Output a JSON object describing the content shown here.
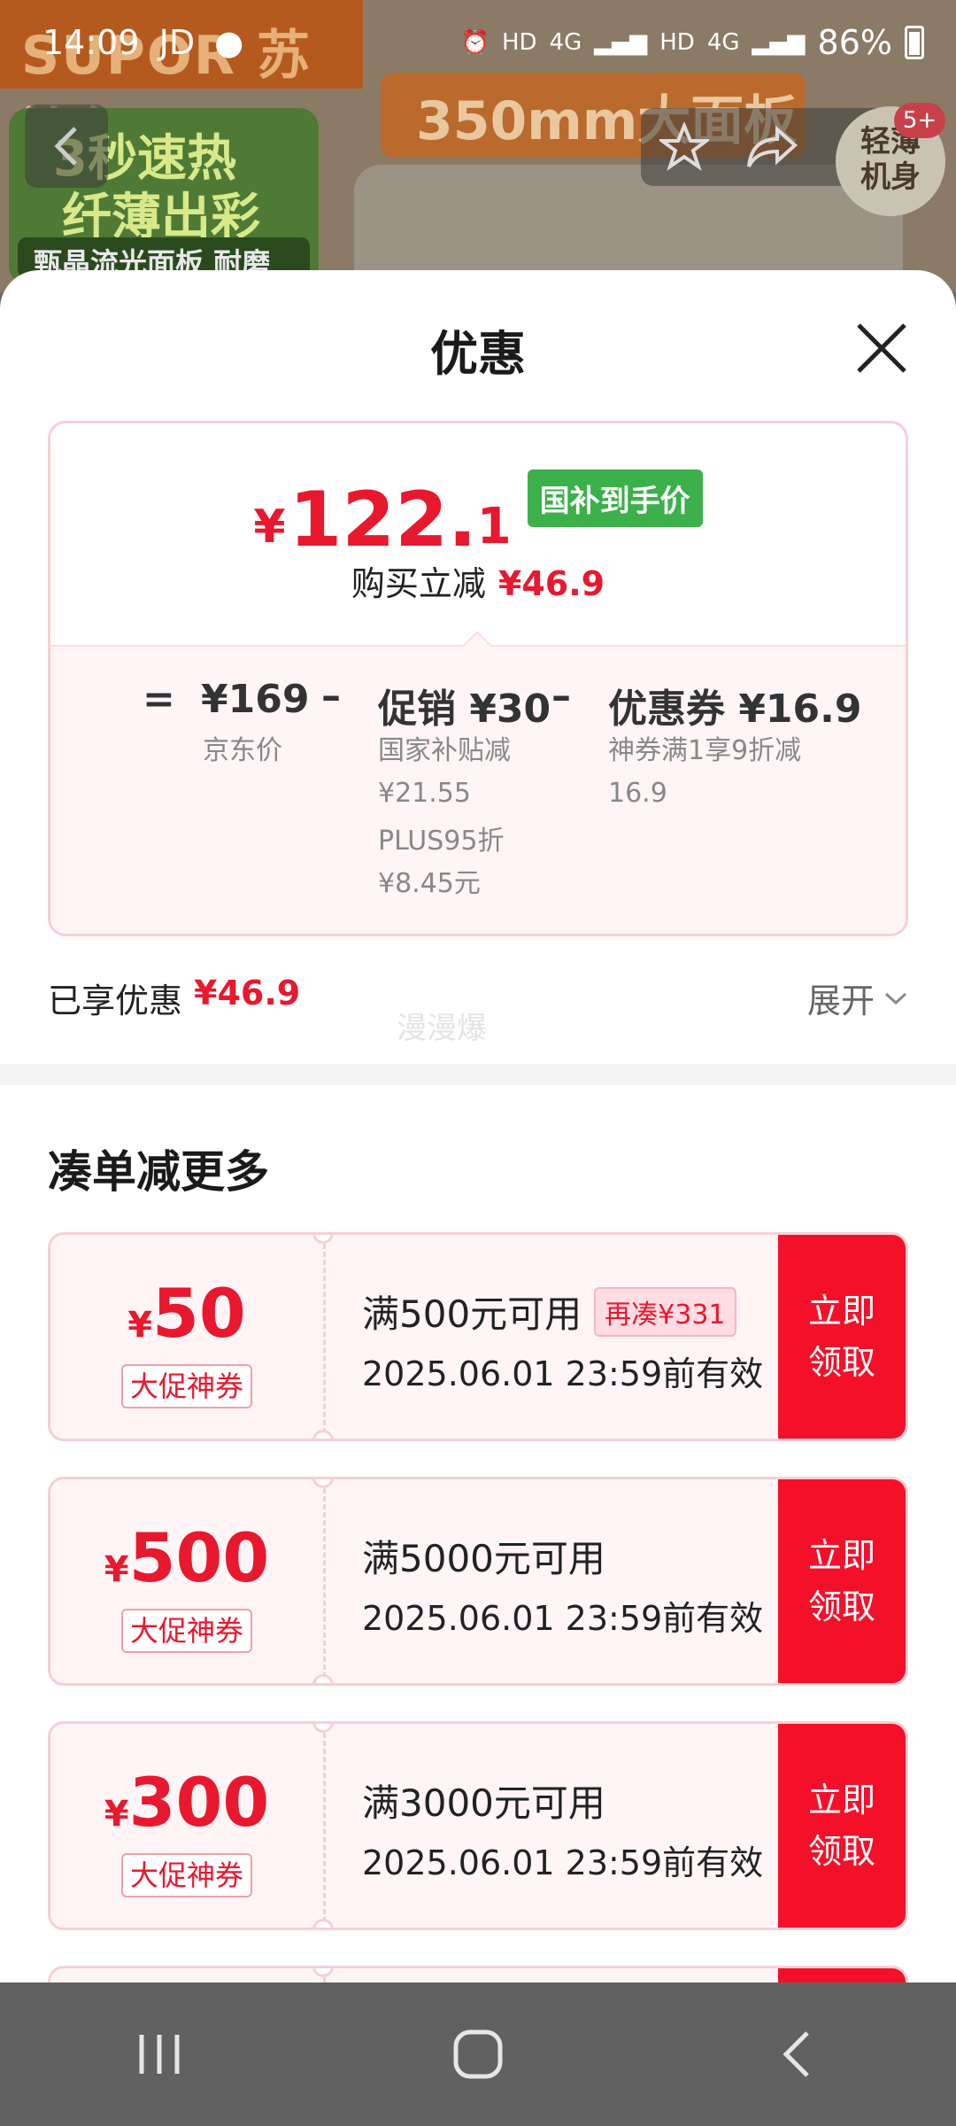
{
  "status_bar": {
    "time": "14:09",
    "carrier": "JD",
    "battery": "86%",
    "network_1": "HD",
    "network_2": "4G",
    "network_3": "HD",
    "network_4": "4G"
  },
  "background_page": {
    "brand_text": "SUPOR 苏泊尔",
    "banner_line_1": "3秒速热",
    "banner_line_2": "纤薄出彩",
    "banner_line_3": "甄晶流光面板 耐磨",
    "banner_mid": "350mm大面板",
    "badge_round": "轻薄\n机身",
    "badge_count": "5+"
  },
  "sheet": {
    "title": "优惠",
    "price": {
      "currency": "¥",
      "integer": "122.",
      "decimal": "1",
      "tag": "国补到手价",
      "saving_label": "购买立减",
      "saving_value": "¥46.9"
    },
    "calculation": {
      "equals": "=",
      "jd_price": "¥169",
      "jd_price_label": "京东价",
      "minus_1": "–",
      "promo_label": "促销 ¥30",
      "promo_detail_1": "国家补贴减",
      "promo_detail_2": "¥21.55",
      "promo_detail_3": "PLUS95折",
      "promo_detail_4": "¥8.45元",
      "minus_2": "–",
      "coupon_label": "优惠券 ¥16.9",
      "coupon_detail_1": "神券满1享9折减",
      "coupon_detail_2": "16.9"
    },
    "enjoyed": {
      "label": "已享优惠",
      "value": "¥46.9",
      "expand": "展开"
    },
    "watermark": "漫漫爆",
    "section_title": "凑单减更多",
    "coupons": [
      {
        "currency": "¥",
        "amount": "50",
        "label": "大促神券",
        "condition": "满500元可用",
        "extra": "再凑¥331",
        "expiry": "2025.06.01 23:59前有效",
        "button": "立即\n领取"
      },
      {
        "currency": "¥",
        "amount": "500",
        "label": "大促神券",
        "condition": "满5000元可用",
        "extra": "",
        "expiry": "2025.06.01 23:59前有效",
        "button": "立即\n领取"
      },
      {
        "currency": "¥",
        "amount": "300",
        "label": "大促神券",
        "condition": "满3000元可用",
        "extra": "",
        "expiry": "2025.06.01 23:59前有效",
        "button": "立即\n领取"
      }
    ]
  },
  "colors": {
    "accent_red": "#e8182e",
    "button_red": "#f5102a",
    "tag_green": "#3cb04a"
  },
  "icons": [
    "back-arrow-icon",
    "star-icon",
    "share-icon",
    "close-icon",
    "chevron-down-icon",
    "recent-apps-icon",
    "home-icon",
    "back-nav-icon"
  ]
}
